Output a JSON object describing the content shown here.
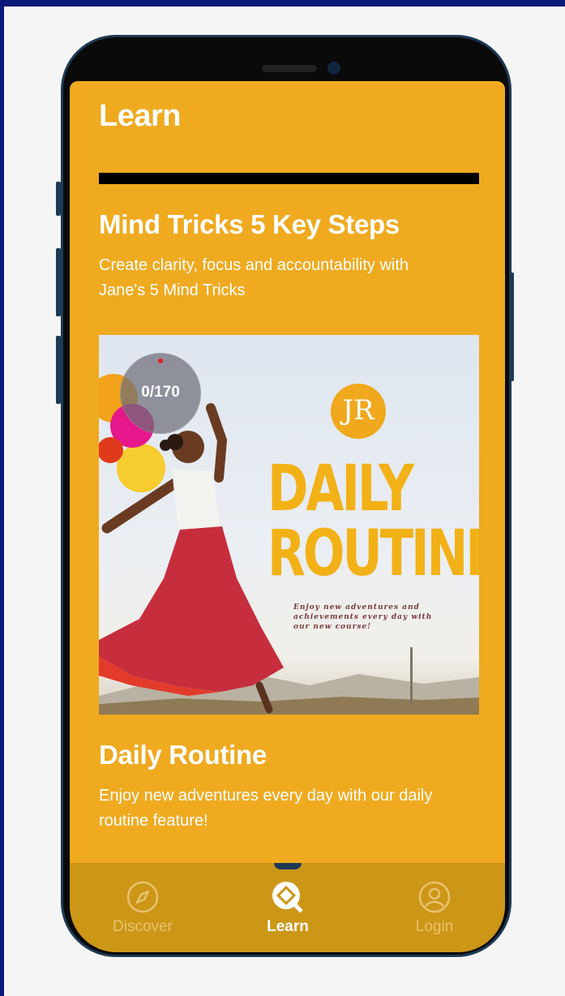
{
  "app": {
    "title": "Learn"
  },
  "lesson_progress": {
    "fraction": 1.0
  },
  "cards": [
    {
      "title": "Mind Tricks 5 Key Steps",
      "subtitle_line1": "Create clarity, focus and accountability with",
      "subtitle_line2": "Jane's 5 Mind Tricks"
    },
    {
      "title": "Daily Routine",
      "subtitle_line1": "Enjoy new adventures every day with our daily",
      "subtitle_line2": "routine feature!"
    }
  ],
  "hero": {
    "logo_text": "JR",
    "title_line1": "DAILY",
    "title_line2": "ROUTINE",
    "tagline_line1": "Enjoy new adventures and",
    "tagline_line2": "achievements every day with",
    "tagline_line3": "our new course!",
    "counter": "0/170"
  },
  "nav": {
    "items": [
      {
        "label": "Discover",
        "icon": "compass-icon",
        "active": false
      },
      {
        "label": "Learn",
        "icon": "learn-icon",
        "active": true
      },
      {
        "label": "Login",
        "icon": "user-icon",
        "active": false
      }
    ]
  },
  "colors": {
    "screen_bg": "#efaa20",
    "navbar_bg": "#cc9617",
    "hero_text": "#f2b116",
    "frame_bg": "#0b1a7a"
  }
}
